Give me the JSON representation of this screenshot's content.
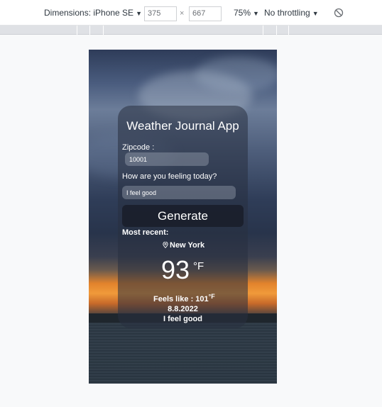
{
  "devtools": {
    "dimensions_label": "Dimensions: iPhone SE",
    "width_value": "375",
    "times": "×",
    "height_value": "667",
    "zoom_label": "75%",
    "throttling_label": "No throttling",
    "caret": "▼",
    "rotate_icon": "rotate-icon"
  },
  "app": {
    "title": "Weather Journal App",
    "zipcode_label": "Zipcode :",
    "zipcode_value": "10001",
    "feelings_label": "How are you feeling today?",
    "feelings_value": "I feel good",
    "generate_label": "Generate",
    "most_recent_label": "Most recent:",
    "city": "New York",
    "pin_icon": "location-pin-icon",
    "temperature": "93",
    "temperature_unit": "°F",
    "feels_like": "Feels like : 101",
    "feels_like_unit": "°F",
    "date": "8.8.2022",
    "feeling_entry": "I feel good"
  }
}
